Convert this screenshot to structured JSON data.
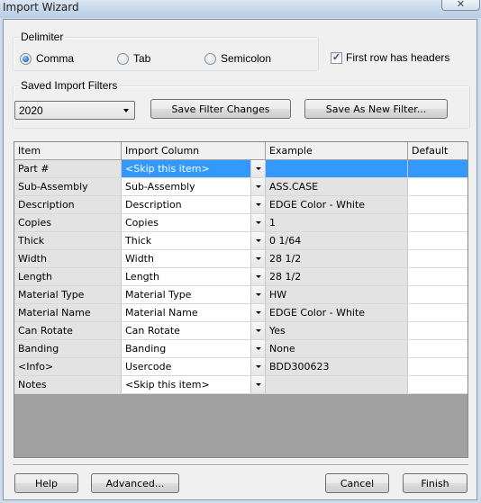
{
  "window": {
    "title": "Import Wizard",
    "close_glyph": "✕"
  },
  "delimiter": {
    "label": "Delimiter",
    "options": [
      {
        "label": "Comma",
        "selected": true
      },
      {
        "label": "Tab",
        "selected": false
      },
      {
        "label": "Semicolon",
        "selected": false
      }
    ]
  },
  "first_row_headers": {
    "label": "First row has headers",
    "checked": true,
    "check_glyph": "✓"
  },
  "saved_filters": {
    "label": "Saved Import Filters",
    "selected_filter": "2020",
    "save_changes_label": "Save Filter Changes",
    "save_as_new_label": "Save As New Filter..."
  },
  "grid": {
    "columns": [
      "Item",
      "Import Column",
      "Example",
      "Default"
    ],
    "rows": [
      {
        "item": "Part #",
        "import_column": "<Skip this item>",
        "example": "",
        "default": "",
        "selected": true
      },
      {
        "item": "Sub-Assembly",
        "import_column": "Sub-Assembly",
        "example": "ASS.CASE",
        "default": ""
      },
      {
        "item": "Description",
        "import_column": "Description",
        "example": "EDGE Color - White",
        "default": ""
      },
      {
        "item": "Copies",
        "import_column": "Copies",
        "example": "1",
        "default": ""
      },
      {
        "item": "Thick",
        "import_column": "Thick",
        "example": "0 1/64",
        "default": ""
      },
      {
        "item": "Width",
        "import_column": "Width",
        "example": "28 1/2",
        "default": ""
      },
      {
        "item": "Length",
        "import_column": "Length",
        "example": "28 1/2",
        "default": ""
      },
      {
        "item": "Material Type",
        "import_column": "Material Type",
        "example": "HW",
        "default": ""
      },
      {
        "item": "Material Name",
        "import_column": "Material Name",
        "example": "EDGE Color - White",
        "default": ""
      },
      {
        "item": "Can Rotate",
        "import_column": "Can Rotate",
        "example": "Yes",
        "default": ""
      },
      {
        "item": "Banding",
        "import_column": "Banding",
        "example": "None",
        "default": ""
      },
      {
        "item": "<Info>",
        "import_column": "Usercode",
        "example": "BDD300623",
        "default": ""
      },
      {
        "item": "Notes",
        "import_column": "<Skip this item>",
        "example": "",
        "default": ""
      }
    ]
  },
  "footer": {
    "help_label": "Help",
    "advanced_label": "Advanced...",
    "cancel_label": "Cancel",
    "finish_label": "Finish"
  }
}
